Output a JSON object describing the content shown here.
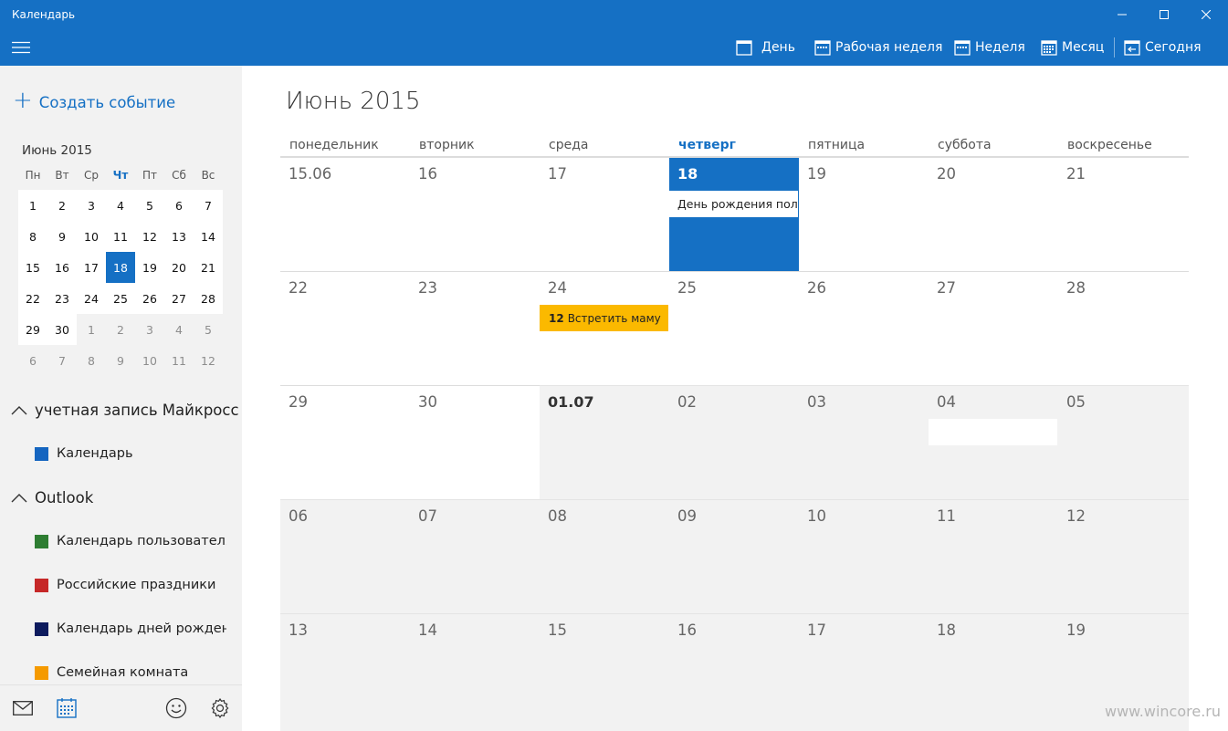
{
  "window": {
    "title": "Календарь"
  },
  "toolbar": {
    "day_label": "День",
    "workweek_label": "Рабочая неделя",
    "week_label": "Неделя",
    "month_label": "Месяц",
    "today_label": "Сегодня"
  },
  "sidebar": {
    "create_label": "Создать событие",
    "mini_calendar": {
      "title": "Июнь 2015",
      "weekdays": [
        "Пн",
        "Вт",
        "Ср",
        "Чт",
        "Пт",
        "Сб",
        "Вс"
      ],
      "weeks": [
        [
          "1",
          "2",
          "3",
          "4",
          "5",
          "6",
          "7"
        ],
        [
          "8",
          "9",
          "10",
          "11",
          "12",
          "13",
          "14"
        ],
        [
          "15",
          "16",
          "17",
          "18",
          "19",
          "20",
          "21"
        ],
        [
          "22",
          "23",
          "24",
          "25",
          "26",
          "27",
          "28"
        ],
        [
          "29",
          "30",
          "1",
          "2",
          "3",
          "4",
          "5"
        ],
        [
          "6",
          "7",
          "8",
          "9",
          "10",
          "11",
          "12"
        ]
      ]
    },
    "accounts": [
      {
        "name": "учетная запись Майкросс",
        "calendars": [
          {
            "name": "Календарь",
            "color": "#1565c0"
          }
        ]
      },
      {
        "name": "Outlook",
        "calendars": [
          {
            "name": "Календарь пользователя Е",
            "color": "#2e7d32"
          },
          {
            "name": "Российские праздники",
            "color": "#c62828"
          },
          {
            "name": "Календарь дней рождения",
            "color": "#0d1b5e"
          },
          {
            "name": "Семейная комната",
            "color": "#f59a00"
          }
        ]
      }
    ]
  },
  "main": {
    "month_title": "Июнь 2015",
    "weekdays": [
      "понедельник",
      "вторник",
      "среда",
      "четверг",
      "пятница",
      "суббота",
      "воскресенье"
    ],
    "weeks": [
      [
        "15.06",
        "16",
        "17",
        "18",
        "19",
        "20",
        "21"
      ],
      [
        "22",
        "23",
        "24",
        "25",
        "26",
        "27",
        "28"
      ],
      [
        "29",
        "30",
        "01.07",
        "02",
        "03",
        "04",
        "05"
      ],
      [
        "06",
        "07",
        "08",
        "09",
        "10",
        "11",
        "12"
      ],
      [
        "13",
        "14",
        "15",
        "16",
        "17",
        "18",
        "19"
      ]
    ],
    "events": {
      "birthday": "День рождения поль",
      "meet_mom_time": "12",
      "meet_mom_title": "Встретить маму"
    }
  },
  "watermark": "www.wincore.ru",
  "colors": {
    "accent": "#1570c4",
    "event_yellow": "#fbb900",
    "out_of_month_bg": "#f2f2f2"
  }
}
